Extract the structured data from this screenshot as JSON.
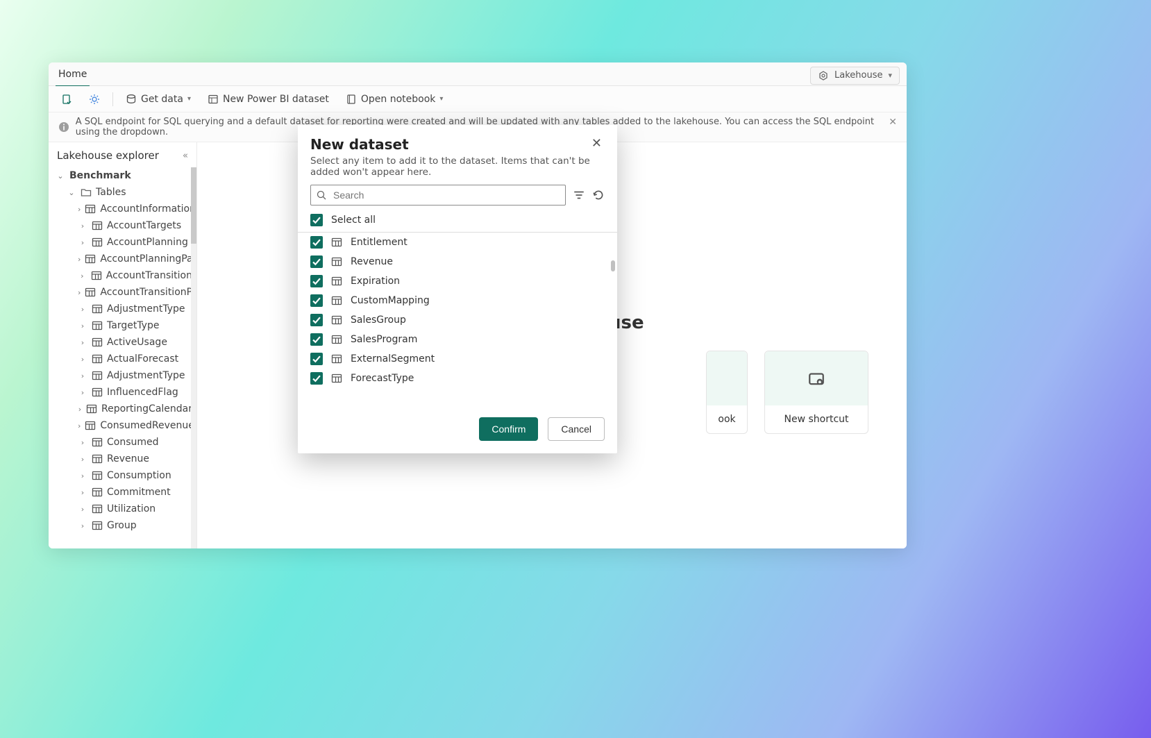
{
  "tabs": {
    "home": "Home"
  },
  "header": {
    "lakehouse_pill": "Lakehouse"
  },
  "toolbar": {
    "get_data": "Get data",
    "new_dataset": "New Power BI dataset",
    "open_notebook": "Open notebook"
  },
  "info_bar": "A SQL endpoint for SQL querying and a default dataset for reporting were created and will be updated with any tables added to the lakehouse. You can access the SQL endpoint using the dropdown.",
  "sidebar": {
    "title": "Lakehouse explorer",
    "root": "Benchmark",
    "tables_label": "Tables",
    "tables": [
      "AccountInformation",
      "AccountTargets",
      "AccountPlanning",
      "AccountPlanningParticipants",
      "AccountTransition",
      "AccountTransitionPulseSurvey",
      "AdjustmentType",
      "TargetType",
      "ActiveUsage",
      "ActualForecast",
      "AdjustmentType",
      "InfluencedFlag",
      "ReportingCalendar",
      "ConsumedRevenue",
      "Consumed",
      "Revenue",
      "Consumption",
      "Commitment",
      "Utilization",
      "Group"
    ]
  },
  "main": {
    "peek_suffix": "use",
    "card_notebook": "ook",
    "card_shortcut": "New shortcut"
  },
  "modal": {
    "title": "New dataset",
    "subtitle": "Select any item to add it to the dataset. Items that can't be added won't appear here.",
    "search_placeholder": "Search",
    "select_all": "Select all",
    "items": [
      "Entitlement",
      "Revenue",
      "Expiration",
      "CustomMapping",
      "SalesGroup",
      "SalesProgram",
      "ExternalSegment",
      "ForecastType"
    ],
    "confirm": "Confirm",
    "cancel": "Cancel"
  },
  "colors": {
    "accent": "#0f6e5f"
  }
}
